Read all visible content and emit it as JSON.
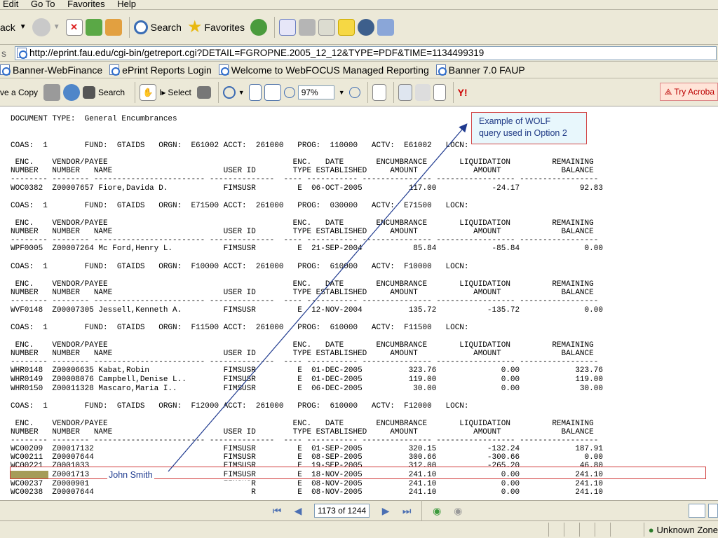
{
  "menu": [
    "Edit",
    "Go To",
    "Favorites",
    "Help"
  ],
  "toolbar": {
    "back_label": "ack",
    "search_label": "Search",
    "favorites_label": "Favorites"
  },
  "address": {
    "prefix": "s",
    "url": "http://eprint.fau.edu/cgi-bin/getreport.cgi?DETAIL=FGROPNE.2005_12_12&TYPE=PDF&TIME=1134499319"
  },
  "links": [
    "Banner-WebFinance",
    "ePrint Reports Login",
    "Welcome to WebFOCUS Managed Reporting",
    "Banner 7.0 FAUP"
  ],
  "acrobat": {
    "save_copy": "ve a Copy",
    "search": "Search",
    "select": "Select",
    "zoom": "97%",
    "try_acrobat": "Try Acroba"
  },
  "document": {
    "title_line": "DOCUMENT TYPE:  General Encumbrances",
    "header1": " ENC.    VENDOR/PAYEE                                        ENC.   DATE       ENCUMBRANCE       LIQUIDATION         REMAINING",
    "header2": "NUMBER   NUMBER   NAME                        USER ID        TYPE ESTABLISHED     AMOUNT            AMOUNT             BALANCE",
    "rule": "-------- -------- ------------------------ --------------  ---- ----------- --------------- ----------------- -----------------",
    "sections": [
      {
        "coas": "COAS:  1        FUND:  GTAIDS   ORGN:  E61002 ACCT:  261000   PROG:  110000   ACTV:  E61002   LOCN:",
        "rows": [
          "WOC0382  Z00007657 Fiore,Davida D.            FIMSUSR         E  06-OCT-2005          117.00            -24.17             92.83"
        ]
      },
      {
        "coas": "COAS:  1        FUND:  GTAIDS   ORGN:  E71500 ACCT:  261000   PROG:  030000   ACTV:  E71500   LOCN:",
        "rows": [
          "WPF0005  Z00007264 Mc Ford,Henry L.           FIMSUSR         E  21-SEP-2004           85.84            -85.84              0.00"
        ]
      },
      {
        "coas": "COAS:  1        FUND:  GTAIDS   ORGN:  F10000 ACCT:  261000   PROG:  610000   ACTV:  F10000   LOCN:",
        "rows": [
          "WVF0148  Z00007305 Jessell,Kenneth A.         FIMSUSR         E  12-NOV-2004          135.72           -135.72              0.00"
        ]
      },
      {
        "coas": "COAS:  1        FUND:  GTAIDS   ORGN:  F11500 ACCT:  261000   PROG:  610000   ACTV:  F11500   LOCN:",
        "rows": [
          "WHR0148  Z00006635 Kabat,Robin                FIMSUSR         E  01-DEC-2005          323.76              0.00            323.76",
          "WHR0149  Z00008076 Campbell,Denise L..        FIMSUSR         E  01-DEC-2005          119.00              0.00            119.00",
          "WHR0150  Z00011328 Mascaro,Maria I..          FIMSUSR         E  06-DEC-2005           30.00              0.00             30.00"
        ]
      },
      {
        "coas": "COAS:  1        FUND:  GTAIDS   ORGN:  F12000 ACCT:  261000   PROG:  610000   ACTV:  F12000   LOCN:",
        "rows": [
          "WC00209  Z00017132                            FIMSUSR         E  01-SEP-2005          320.15           -132.24            187.91",
          "WC00211  Z00007644                            FIMSUSR         E  08-SEP-2005          300.66           -300.66              0.00",
          "WC00221  Z0001033                             FIMSUSR         E  19-SEP-2005          312.00           -265.20             46.80",
          "WC00236  Z0001713                             FIMSUSR         E  18-NOV-2005          241.10              0.00            241.10",
          "WC00237  Z0000901                             FIMSUSR         E  08-NOV-2005          241.10              0.00            241.10",
          "WC00238  Z00007644                            FIMSUSR         E  08-NOV-2005          241.10              0.00            241.10"
        ]
      }
    ]
  },
  "annotation": {
    "callout_line1": "Example of WOLF",
    "callout_line2": "query used in Option 2",
    "name_label": "John Smith"
  },
  "nav": {
    "page": "1173 of 1244"
  },
  "status": {
    "zone": "Unknown Zone"
  }
}
